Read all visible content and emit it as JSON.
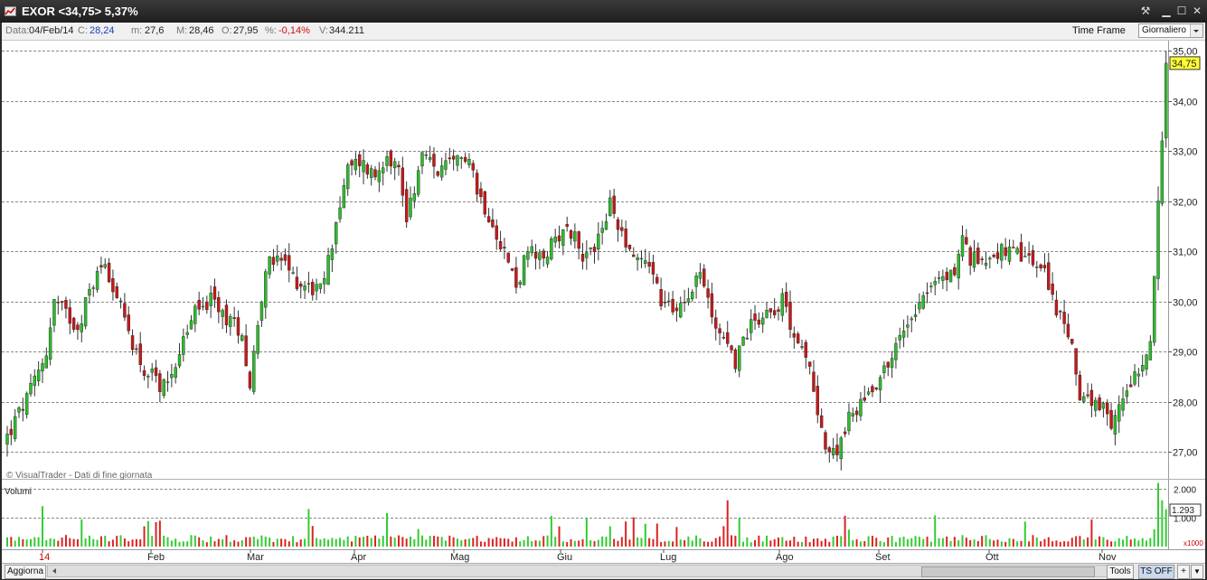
{
  "window": {
    "title": "EXOR <34,75> 5,37%",
    "buttons": {
      "tool": "⚒",
      "minimize": "▁",
      "maximize": "☐",
      "close": "✕"
    }
  },
  "infobar": {
    "date_label": "Data:",
    "date_value": "04/Feb/14",
    "close_label": "C:",
    "close_value": "28,24",
    "min_label": "m:",
    "min_value": "27,6",
    "max_label": "M:",
    "max_value": "28,46",
    "open_label": "O:",
    "open_value": "27,95",
    "pct_label": "%:",
    "pct_value": "-0,14%",
    "vol_label": "V:",
    "vol_value": "344.211",
    "timeframe_label": "Time Frame",
    "timeframe_value": "Giornaliero"
  },
  "colors": {
    "up": "#2dbb2d",
    "down": "#c81818",
    "up_vol": "#33cc33",
    "down_vol": "#dd2222",
    "grid": "#8a8a8a",
    "current_price_bg": "#ffff33"
  },
  "chart_data": {
    "type": "candlestick",
    "price_ylim": [
      26.4,
      35.1
    ],
    "price_ticks": [
      "27,00",
      "28,00",
      "29,00",
      "30,00",
      "31,00",
      "32,00",
      "33,00",
      "34,00",
      "35,00"
    ],
    "current_price": "34,75",
    "watermark": "© VisualTrader - Dati di fine giornata",
    "volume_title": "Volumi",
    "volume_ticks": [
      "1.000",
      "2.000"
    ],
    "volume_last": "1.293",
    "volume_unit": "x1000",
    "x_labels": [
      "14",
      "Feb",
      "Mar",
      "Apr",
      "Mag",
      "Giu",
      "Lug",
      "Ago",
      "Set",
      "Ott",
      "Nov"
    ],
    "grid": true,
    "series": [
      {
        "name": "price",
        "close_anchors": [
          [
            0,
            27.3
          ],
          [
            6,
            28.2
          ],
          [
            10,
            29.0
          ],
          [
            12,
            30.0
          ],
          [
            18,
            29.5
          ],
          [
            22,
            30.4
          ],
          [
            25,
            30.8
          ],
          [
            30,
            29.6
          ],
          [
            35,
            28.6
          ],
          [
            40,
            28.3
          ],
          [
            44,
            29.0
          ],
          [
            48,
            29.8
          ],
          [
            52,
            30.0
          ],
          [
            57,
            29.6
          ],
          [
            60,
            29.4
          ],
          [
            62,
            28.3
          ],
          [
            64,
            29.6
          ],
          [
            66,
            30.7
          ],
          [
            70,
            30.8
          ],
          [
            74,
            30.4
          ],
          [
            80,
            30.2
          ],
          [
            82,
            30.8
          ],
          [
            84,
            31.6
          ],
          [
            87,
            32.6
          ],
          [
            90,
            32.8
          ],
          [
            94,
            32.5
          ],
          [
            97,
            33.0
          ],
          [
            100,
            32.6
          ],
          [
            102,
            31.7
          ],
          [
            104,
            32.3
          ],
          [
            106,
            32.9
          ],
          [
            110,
            32.6
          ],
          [
            114,
            32.7
          ],
          [
            118,
            33.0
          ],
          [
            120,
            32.2
          ],
          [
            124,
            31.6
          ],
          [
            127,
            31.0
          ],
          [
            130,
            30.3
          ],
          [
            133,
            31.0
          ],
          [
            136,
            30.8
          ],
          [
            139,
            31.1
          ],
          [
            142,
            31.5
          ],
          [
            145,
            31.3
          ],
          [
            148,
            30.8
          ],
          [
            151,
            31.3
          ],
          [
            154,
            31.9
          ],
          [
            157,
            31.4
          ],
          [
            160,
            30.9
          ],
          [
            164,
            30.8
          ],
          [
            167,
            30.0
          ],
          [
            170,
            29.8
          ],
          [
            174,
            30.2
          ],
          [
            177,
            30.6
          ],
          [
            180,
            29.7
          ],
          [
            183,
            29.3
          ],
          [
            186,
            28.8
          ],
          [
            190,
            29.6
          ],
          [
            194,
            29.8
          ],
          [
            198,
            30.0
          ],
          [
            202,
            29.2
          ],
          [
            205,
            28.6
          ],
          [
            207,
            27.9
          ],
          [
            209,
            27.1
          ],
          [
            211,
            26.9
          ],
          [
            214,
            27.5
          ],
          [
            218,
            28.0
          ],
          [
            222,
            28.4
          ],
          [
            226,
            28.9
          ],
          [
            230,
            29.6
          ],
          [
            234,
            30.2
          ],
          [
            238,
            30.4
          ],
          [
            242,
            30.6
          ],
          [
            244,
            31.3
          ],
          [
            246,
            30.8
          ],
          [
            250,
            30.9
          ],
          [
            254,
            31.0
          ],
          [
            258,
            30.9
          ],
          [
            262,
            30.8
          ],
          [
            266,
            30.4
          ],
          [
            268,
            29.8
          ],
          [
            270,
            29.6
          ],
          [
            272,
            29.0
          ],
          [
            274,
            28.2
          ],
          [
            277,
            27.9
          ],
          [
            280,
            27.8
          ],
          [
            282,
            27.4
          ],
          [
            284,
            27.9
          ],
          [
            286,
            28.3
          ],
          [
            288,
            28.6
          ],
          [
            290,
            28.8
          ],
          [
            292,
            29.2
          ],
          [
            293,
            30.5
          ],
          [
            294,
            32.0
          ],
          [
            295,
            33.2
          ],
          [
            296,
            34.75
          ]
        ]
      },
      {
        "name": "volume"
      }
    ]
  },
  "bottombar": {
    "refresh": "Aggiorna",
    "tools": "Tools",
    "ts": "TS OFF",
    "plus": "+",
    "menu": "▼"
  }
}
